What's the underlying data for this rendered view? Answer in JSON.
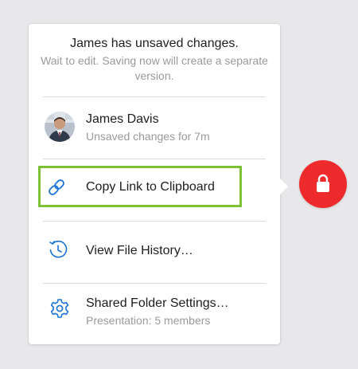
{
  "header": {
    "title": "James has unsaved changes.",
    "subtitle": "Wait to edit. Saving now will create a separate version."
  },
  "user": {
    "name": "James Davis",
    "status": "Unsaved changes for 7m"
  },
  "actions": {
    "copy_link": "Copy Link to Clipboard",
    "file_history": "View File History…",
    "folder_settings": "Shared Folder Settings…",
    "folder_members": "Presentation: 5 members"
  },
  "icons": {
    "link": "link-icon",
    "history": "history-icon",
    "settings": "gear-icon",
    "lock": "lock-icon"
  },
  "colors": {
    "accent": "#1a73d9",
    "highlight": "#7dc234",
    "lock_bg": "#ef2a2c"
  }
}
